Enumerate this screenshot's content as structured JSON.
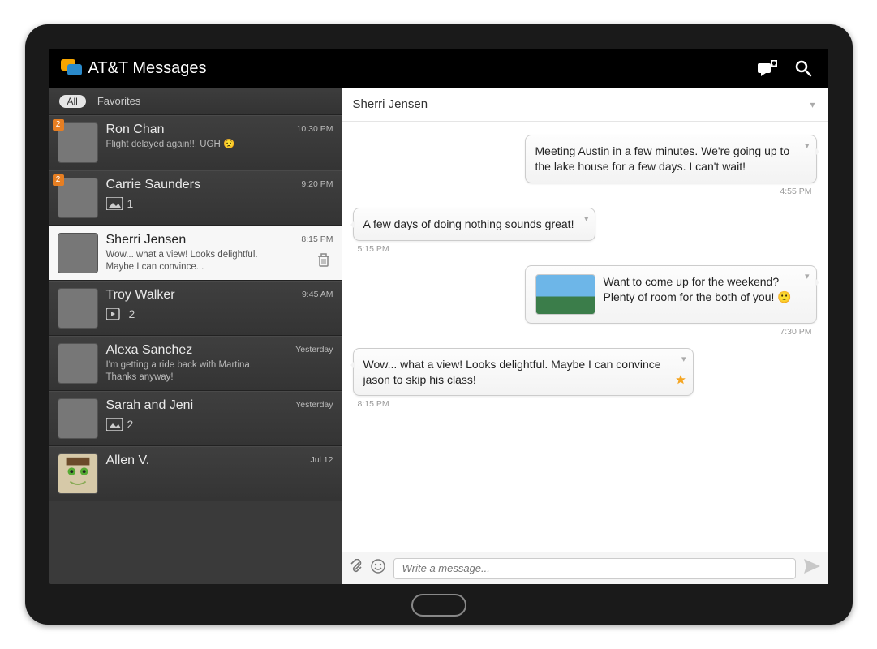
{
  "header": {
    "title": "AT&T Messages"
  },
  "filters": {
    "all": "All",
    "favorites": "Favorites",
    "active": "all"
  },
  "conversations": [
    {
      "name": "Ron Chan",
      "preview": "Flight delayed again!!! UGH 😟",
      "time": "10:30 PM",
      "unread": "2"
    },
    {
      "name": "Carrie Saunders",
      "preview": "",
      "time": "9:20 PM",
      "unread": "2",
      "attachment_count": "1",
      "attachment_type": "image"
    },
    {
      "name": "Sherri Jensen",
      "preview": "Wow... what a view! Looks delightful. Maybe I can convince...",
      "time": "8:15 PM",
      "selected": true,
      "deletable": true
    },
    {
      "name": "Troy Walker",
      "preview": "",
      "time": "9:45 AM",
      "attachment_count": "2",
      "attachment_type": "video"
    },
    {
      "name": "Alexa Sanchez",
      "preview": "I'm getting a ride back with Martina. Thanks anyway!",
      "time": "Yesterday"
    },
    {
      "name": "Sarah and Jeni",
      "preview": "",
      "time": "Yesterday",
      "attachment_count": "2",
      "attachment_type": "image"
    },
    {
      "name": "Allen V.",
      "preview": "",
      "time": "Jul 12"
    }
  ],
  "chat": {
    "title": "Sherri Jensen",
    "input_placeholder": "Write a message...",
    "messages": [
      {
        "side": "right",
        "text": "Meeting Austin in a few minutes. We're going up to the lake house for a few days. I can't wait!",
        "time": "4:55 PM"
      },
      {
        "side": "left",
        "text": "A few days of doing nothing sounds great!",
        "time": "5:15 PM"
      },
      {
        "side": "right",
        "text": "Want to come up for the weekend? Plenty of room for the both of you! 🙂",
        "time": "7:30 PM",
        "has_image": true
      },
      {
        "side": "left",
        "text": "Wow... what a view! Looks delightful. Maybe I can convince jason to skip his class!",
        "time": "8:15 PM",
        "starred": true
      }
    ]
  }
}
